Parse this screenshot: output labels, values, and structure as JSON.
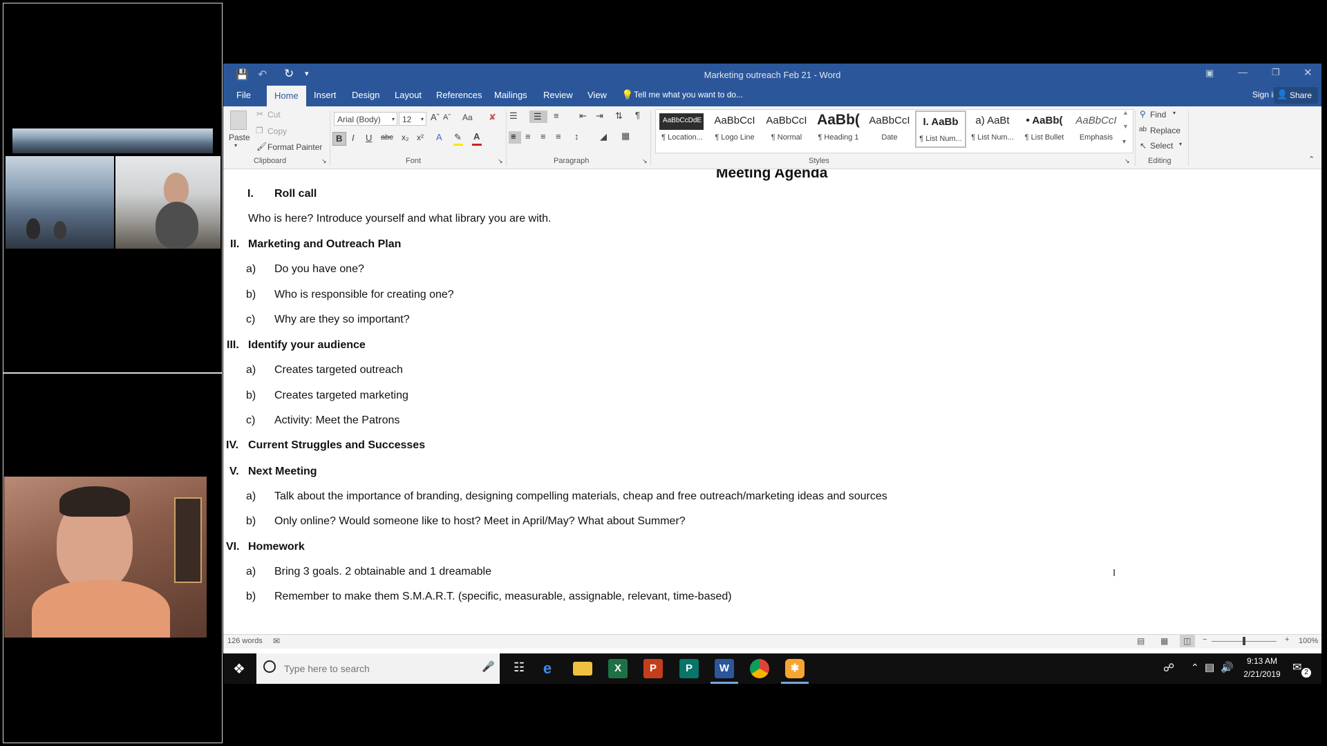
{
  "word": {
    "title": "Marketing outreach Feb 21 - Word",
    "quick_access": {
      "save": "save-icon",
      "undo": "undo-icon",
      "redo": "redo-icon",
      "customize": "▾"
    },
    "tabs": [
      "File",
      "Home",
      "Insert",
      "Design",
      "Layout",
      "References",
      "Mailings",
      "Review",
      "View"
    ],
    "tell_me": "Tell me what you want to do...",
    "sign_in": "Sign in",
    "share": "Share",
    "clipboard": {
      "paste": "Paste",
      "cut": "Cut",
      "copy": "Copy",
      "format_painter": "Format Painter",
      "label": "Clipboard"
    },
    "font": {
      "name": "Arial (Body)",
      "size": "12",
      "label": "Font",
      "case": "Aa",
      "bold": "B",
      "italic": "I",
      "underline": "U",
      "strike": "abc",
      "sub": "x₂",
      "sup": "x²",
      "color_a": "A"
    },
    "paragraph": {
      "label": "Paragraph"
    },
    "styles": {
      "label": "Styles",
      "items": [
        {
          "sample": "AaBbCcDdE",
          "name": "¶ Location..."
        },
        {
          "sample": "AaBbCcI",
          "name": "¶ Logo Line"
        },
        {
          "sample": "AaBbCcI",
          "name": "¶ Normal"
        },
        {
          "sample": "AaBb(",
          "name": "¶ Heading 1"
        },
        {
          "sample": "AaBbCcI",
          "name": "Date"
        },
        {
          "sample": "I.  AaBb",
          "name": "¶ List Num..."
        },
        {
          "sample": "a)  AaBt",
          "name": "¶ List Num..."
        },
        {
          "sample": "•  AaBb(",
          "name": "¶ List Bullet"
        },
        {
          "sample": "AaBbCcI",
          "name": "Emphasis"
        }
      ]
    },
    "editing": {
      "find": "Find",
      "replace": "Replace",
      "select": "Select",
      "label": "Editing"
    },
    "document": {
      "title": "Meeting Agenda",
      "lines": [
        {
          "num": "I.",
          "text": "Roll call",
          "heading": true
        },
        {
          "num": "",
          "text": "Who is here? Introduce yourself and what library you are with.",
          "heading": false
        },
        {
          "num": "II.",
          "text": "Marketing and Outreach Plan",
          "heading": true
        },
        {
          "num": "a)",
          "text": "Do you have one?",
          "heading": false
        },
        {
          "num": "b)",
          "text": "Who is responsible for creating one?",
          "heading": false
        },
        {
          "num": "c)",
          "text": "Why are they so important?",
          "heading": false
        },
        {
          "num": "III.",
          "text": "Identify your audience",
          "heading": true
        },
        {
          "num": "a)",
          "text": "Creates targeted outreach",
          "heading": false
        },
        {
          "num": "b)",
          "text": "Creates targeted marketing",
          "heading": false
        },
        {
          "num": "c)",
          "text": "Activity: Meet the Patrons",
          "heading": false
        },
        {
          "num": "IV.",
          "text": "Current Struggles and Successes",
          "heading": true
        },
        {
          "num": "V.",
          "text": "Next Meeting",
          "heading": true
        },
        {
          "num": "a)",
          "text": "Talk about the importance of branding, designing compelling materials, cheap and free outreach/marketing ideas and sources",
          "heading": false
        },
        {
          "num": "b)",
          "text": "Only online? Would someone like to host? Meet in April/May? What about Summer?",
          "heading": false
        },
        {
          "num": "VI.",
          "text": "Homework",
          "heading": true
        },
        {
          "num": "a)",
          "text": "Bring 3 goals. 2 obtainable and 1 dreamable",
          "heading": false
        },
        {
          "num": "b)",
          "text": "Remember to make them S.M.A.R.T. (specific, measurable, assignable, relevant, time-based)",
          "heading": false
        }
      ]
    },
    "status": {
      "words": "126 words",
      "zoom": "100%",
      "zoom_level": 0.5
    }
  },
  "taskbar": {
    "search_placeholder": "Type here to search",
    "apps": [
      "edge",
      "file-explorer",
      "excel",
      "powerpoint",
      "publisher",
      "word",
      "chrome",
      "other-app"
    ],
    "time": "9:13 AM",
    "date": "2/21/2019",
    "notifications": "2"
  },
  "colors": {
    "word_blue": "#2b579a",
    "taskbar": "#101010"
  }
}
